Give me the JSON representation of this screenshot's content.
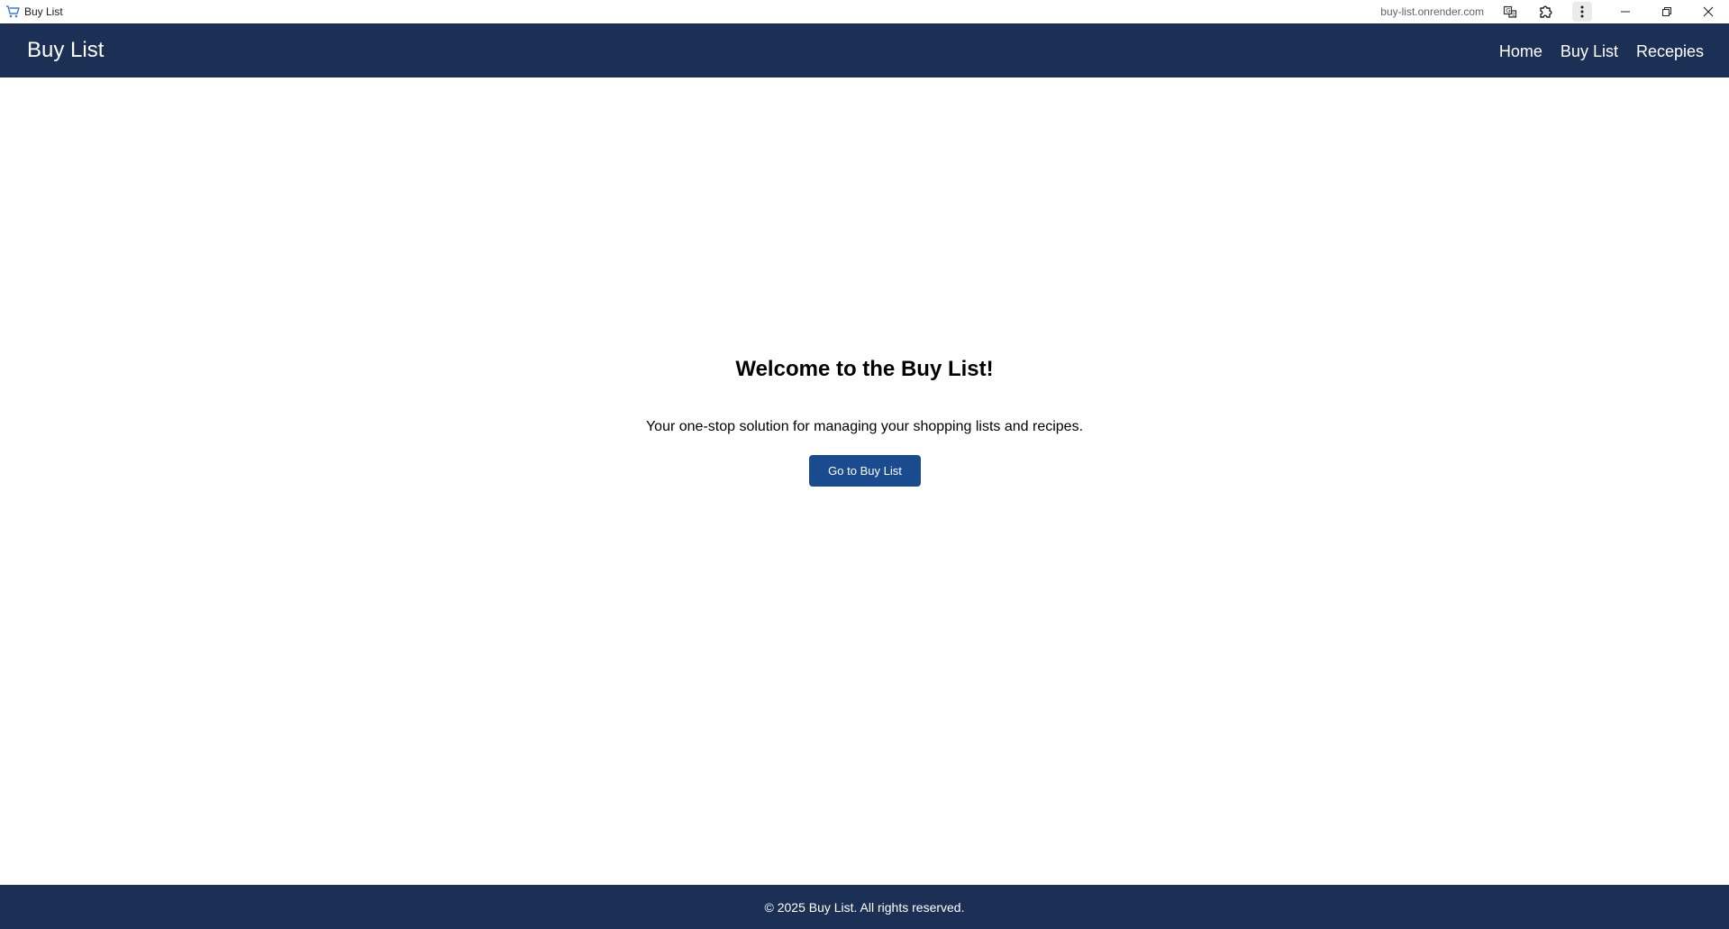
{
  "window": {
    "title": "Buy List",
    "url": "buy-list.onrender.com",
    "icons": {
      "app": "shopping-cart-icon",
      "translate": "translate-icon",
      "extensions": "puzzle-icon",
      "menu": "more-vert-icon",
      "minimize": "minimize-icon",
      "maximize": "restore-icon",
      "close": "close-icon"
    }
  },
  "header": {
    "brand": "Buy List",
    "nav": [
      {
        "label": "Home"
      },
      {
        "label": "Buy List"
      },
      {
        "label": "Recepies"
      }
    ]
  },
  "main": {
    "title": "Welcome to the Buy List!",
    "subtitle": "Your one-stop solution for managing your shopping lists and recipes.",
    "cta_label": "Go to Buy List"
  },
  "footer": {
    "text": "© 2025 Buy List. All rights reserved."
  },
  "colors": {
    "header_bg": "#1b3054",
    "footer_bg": "#1b3054",
    "button_bg": "#1b4b8f"
  }
}
